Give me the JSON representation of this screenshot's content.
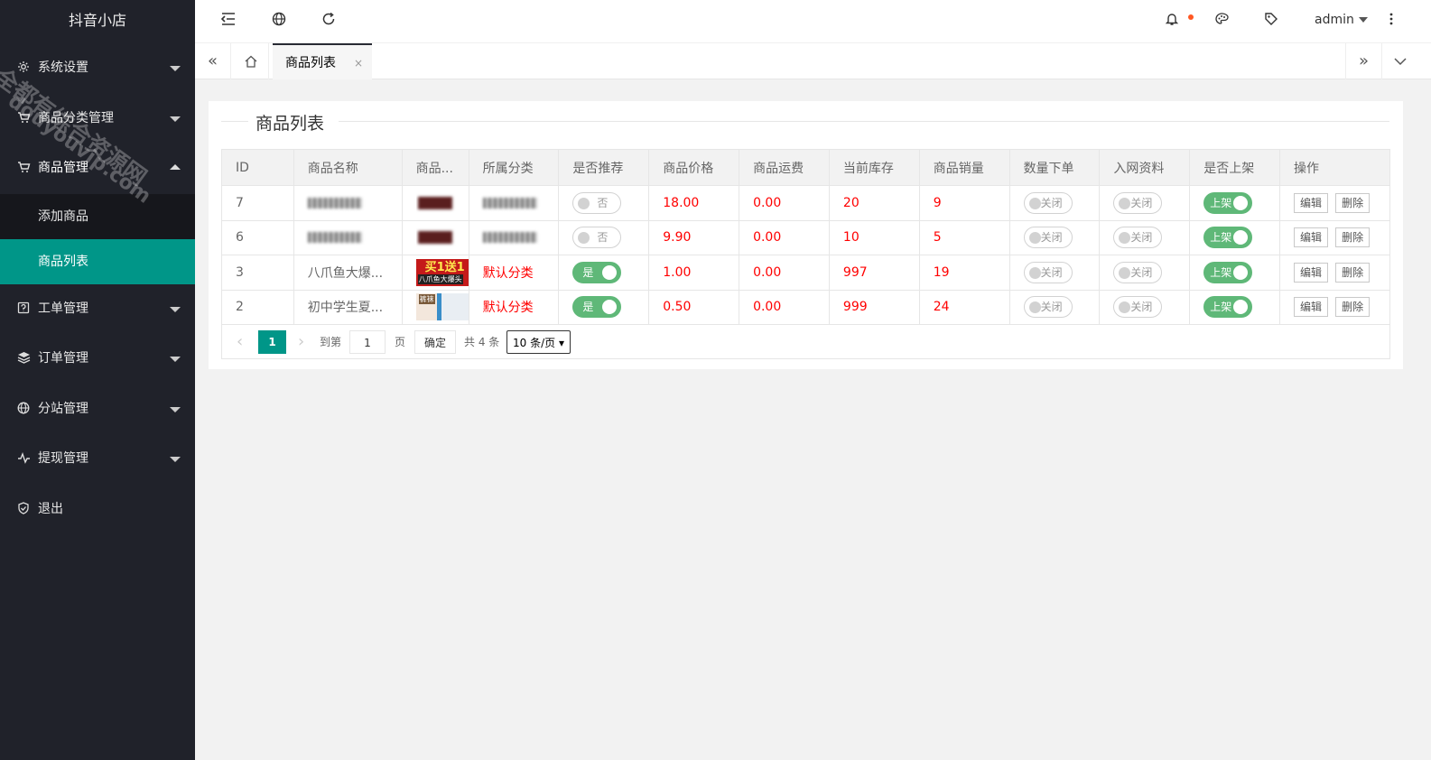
{
  "app": {
    "title": "抖音小店",
    "user": "admin"
  },
  "watermark": {
    "line1": "全都有综合资源网",
    "line2": "douyouvip.com"
  },
  "sidebar": {
    "items": [
      {
        "label": "系统设置",
        "icon": "gear-icon"
      },
      {
        "label": "商品分类管理",
        "icon": "cart-icon"
      },
      {
        "label": "商品管理",
        "icon": "cart-icon",
        "open": true,
        "children": [
          {
            "label": "添加商品"
          },
          {
            "label": "商品列表",
            "active": true
          }
        ]
      },
      {
        "label": "工单管理",
        "icon": "ticket-icon"
      },
      {
        "label": "订单管理",
        "icon": "layers-icon"
      },
      {
        "label": "分站管理",
        "icon": "globe-icon"
      },
      {
        "label": "提现管理",
        "icon": "pulse-icon"
      },
      {
        "label": "退出",
        "icon": "shield-icon"
      }
    ]
  },
  "tabs": [
    {
      "label": "商品列表",
      "close": "×"
    }
  ],
  "panel": {
    "title": "商品列表"
  },
  "table": {
    "headers": [
      "ID",
      "商品名称",
      "商品...",
      "所属分类",
      "是否推荐",
      "商品价格",
      "商品运费",
      "当前库存",
      "商品销量",
      "数量下单",
      "入网资料",
      "是否上架",
      "操作"
    ],
    "rows": [
      {
        "id": "7",
        "name": "",
        "category": "",
        "recommend": "否",
        "recommend_on": false,
        "price": "18.00",
        "freight": "0.00",
        "stock": "20",
        "sales": "9",
        "qty": "关闭",
        "net": "关闭",
        "shelf": "上架",
        "thumb": "dark"
      },
      {
        "id": "6",
        "name": "",
        "category": "",
        "recommend": "否",
        "recommend_on": false,
        "price": "9.90",
        "freight": "0.00",
        "stock": "10",
        "sales": "5",
        "qty": "关闭",
        "net": "关闭",
        "shelf": "上架",
        "thumb": "dark"
      },
      {
        "id": "3",
        "name": "八爪鱼大爆...",
        "category": "默认分类",
        "recommend": "是",
        "recommend_on": true,
        "price": "1.00",
        "freight": "0.00",
        "stock": "997",
        "sales": "19",
        "qty": "关闭",
        "net": "关闭",
        "shelf": "上架",
        "thumb": "red",
        "thumb_text": "买1送1",
        "thumb_text2": "八爪鱼大爆头"
      },
      {
        "id": "2",
        "name": "初中学生夏...",
        "category": "默认分类",
        "recommend": "是",
        "recommend_on": true,
        "price": "0.50",
        "freight": "0.00",
        "stock": "999",
        "sales": "24",
        "qty": "关闭",
        "net": "关闭",
        "shelf": "上架",
        "thumb": "photo",
        "thumb_text": "裤袜"
      }
    ],
    "edit_label": "编辑",
    "delete_label": "删除"
  },
  "pager": {
    "prev": "‹",
    "current": "1",
    "next": "›",
    "goto_label": "到第",
    "goto_value": "1",
    "page_unit": "页",
    "confirm": "确定",
    "total": "共 4 条",
    "per_page": "10 条/页"
  }
}
